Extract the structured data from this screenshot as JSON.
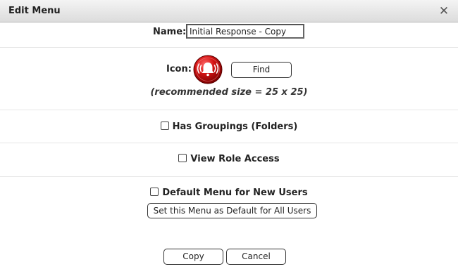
{
  "dialog": {
    "title": "Edit Menu",
    "close_glyph": "✕"
  },
  "name_field": {
    "label": "Name:",
    "value": "Initial Response - Copy"
  },
  "icon_field": {
    "label": "Icon:",
    "icon": "alarm-bell-icon",
    "icon_color": "#c00000",
    "find_label": "Find",
    "recommended_text": "(recommended size = 25 x 25)"
  },
  "options": {
    "has_groupings": {
      "label": "Has Groupings (Folders)",
      "checked": false
    },
    "view_role_access": {
      "label": "View Role Access",
      "checked": false
    },
    "default_menu": {
      "label": "Default Menu for New Users",
      "checked": false
    },
    "set_default_all_label": "Set this Menu as Default for All Users"
  },
  "footer": {
    "copy_label": "Copy",
    "cancel_label": "Cancel"
  }
}
